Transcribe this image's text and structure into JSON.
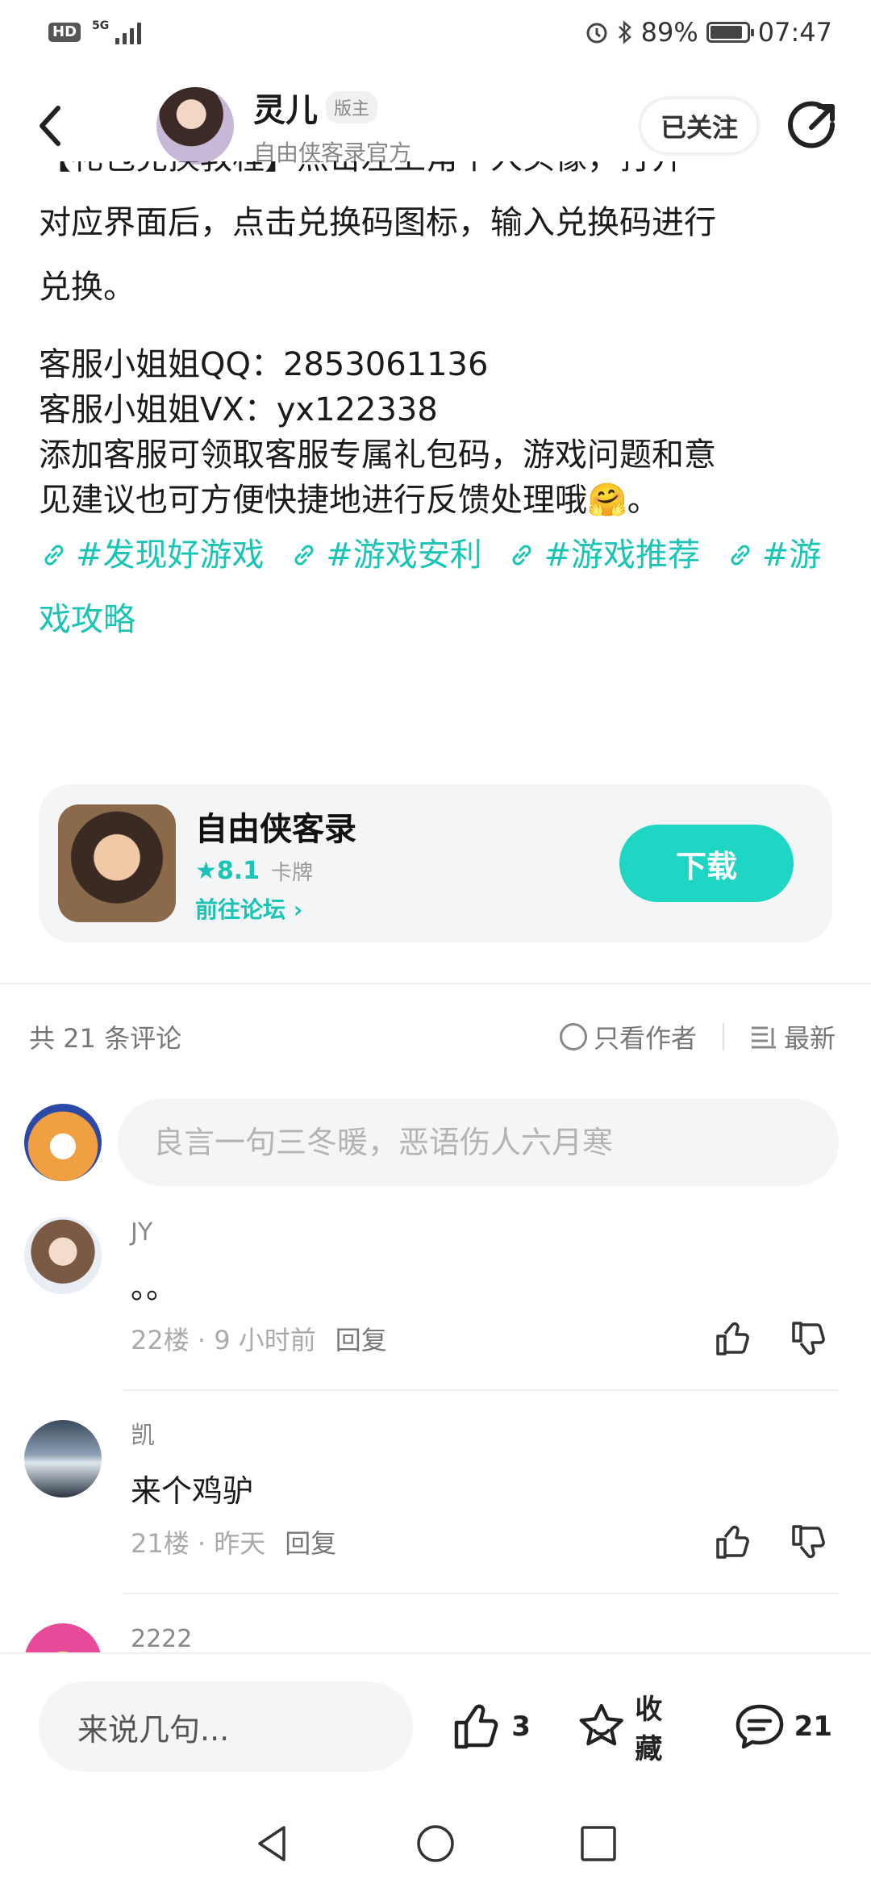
{
  "status_bar": {
    "hd": "HD",
    "network": "5G",
    "battery": "89%",
    "time": "07:47",
    "icons": [
      "alarm-icon",
      "bluetooth-icon",
      "battery-icon"
    ]
  },
  "header": {
    "host_name": "灵儿",
    "host_badge": "版主",
    "host_subtitle": "自由侠客录官方",
    "follow_label": "已关注"
  },
  "article": {
    "lines": [
      "对应界面后，点击兑换码图标，输入兑换码进行",
      "兑换。",
      "客服小姐姐QQ：2853061136",
      "客服小姐姐VX：yx122338",
      "添加客服可领取客服专属礼包码，游戏问题和意",
      "见建议也可方便快捷地进行反馈处理哦🤗。"
    ],
    "cut_line": "【礼包兑换教程】点击左上角个人头像，打开",
    "tags": [
      "#发现好游戏",
      "#游戏安利",
      "#游戏推荐",
      "#游戏攻略"
    ]
  },
  "game_card": {
    "name": "自由侠客录",
    "rating": "★8.1",
    "genre": "卡牌",
    "forum_link": "前往论坛 ›",
    "download_label": "下载"
  },
  "comments_section": {
    "count_label": "共 21 条评论",
    "filter_author": "只看作者",
    "sort_label": "最新",
    "input_placeholder": "良言一句三冬暖，恶语伤人六月寒",
    "reply_label": "回复",
    "items": [
      {
        "user": "JY",
        "text": "。。",
        "meta": "22楼 · 9 小时前"
      },
      {
        "user": "凯",
        "text": "来个鸡驴",
        "meta": "21楼 · 昨天"
      },
      {
        "user": "2222",
        "text": "",
        "meta": ""
      }
    ]
  },
  "bottom_bar": {
    "say_placeholder": "来说几句...",
    "likes": "3",
    "favorite_label": "收藏",
    "comments": "21"
  },
  "colors": {
    "accent": "#18c4b4",
    "download": "#1fd5c3"
  }
}
